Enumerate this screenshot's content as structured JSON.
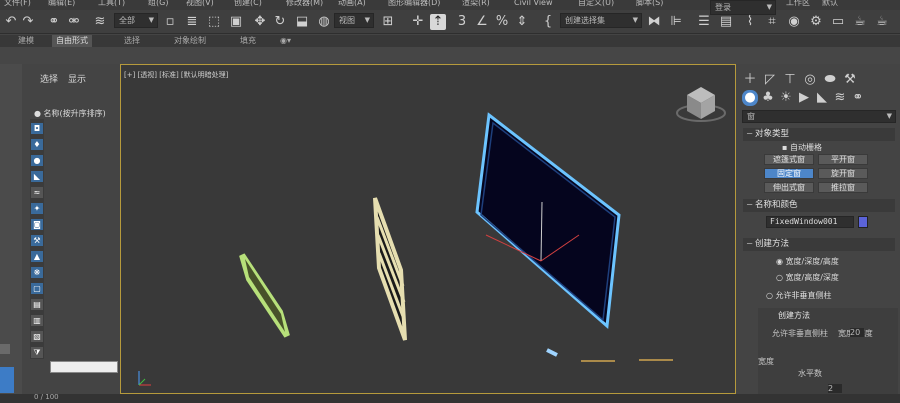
{
  "menu": {
    "items": [
      "文件(F)",
      "编辑(E)",
      "工具(T)",
      "组(G)",
      "视图(V)",
      "创建(C)",
      "修改器(M)",
      "动画(A)",
      "图形编辑器(D)",
      "渲染(R)",
      "Civil View",
      "自定义(U)",
      "脚本(S)",
      "工作区",
      "默认"
    ]
  },
  "toolbar": {
    "filter_value": "全部",
    "view_value": "视图",
    "selection_set_placeholder": "创建选择集",
    "login": "登录",
    "icons": [
      "undo-icon",
      "redo-icon",
      "link-icon",
      "unlink-icon",
      "bind-icon",
      "filter-icon",
      "select-icon",
      "region-select-icon",
      "window-crossing-icon",
      "move-icon",
      "rotate-icon",
      "scale-icon",
      "place-icon",
      "snap-icon",
      "percent-snap-icon",
      "spinner-snap-icon",
      "mirror-icon",
      "align-icon",
      "layer-icon",
      "curve-editor-icon",
      "schematic-icon",
      "material-icon",
      "render-setup-icon",
      "render-frame-icon",
      "render-icon"
    ]
  },
  "ribbon": {
    "tabs": [
      "建模",
      "自由形式",
      "选择",
      "对象绘制",
      "填充"
    ],
    "active": "自由形式"
  },
  "explorer": {
    "tabs": [
      "选择",
      "显示"
    ],
    "header": "名称(按升序排序)"
  },
  "viewport": {
    "label": "[+] [透视] [标准] [默认明暗处理]"
  },
  "command_panel": {
    "category": "窗",
    "object_type_title": "对象类型",
    "auto_grid": "自动栅格",
    "buttons": [
      {
        "label": "遮篷式窗",
        "active": false
      },
      {
        "label": "平开窗",
        "active": false
      },
      {
        "label": "固定窗",
        "active": true
      },
      {
        "label": "旋开窗",
        "active": false
      },
      {
        "label": "伸出式窗",
        "active": false
      },
      {
        "label": "推拉窗",
        "active": false
      }
    ],
    "name_color_title": "名称和颜色",
    "object_name": "FixedWindow001",
    "object_color": "#5b63d8",
    "creation_method_title": "创建方法",
    "creation_options": [
      {
        "label": "宽度/深度/高度",
        "selected": true
      },
      {
        "label": "宽度/高度/深度",
        "selected": false
      }
    ],
    "allow_non_vertical": "允许非垂直侧柱",
    "overlay_lines": [
      "创建方法",
      "允许非垂直侧柱",
      "宽度/深度",
      "宽度",
      "水平数",
      "20",
      "2"
    ]
  },
  "status": {
    "frame": "0 / 100"
  }
}
